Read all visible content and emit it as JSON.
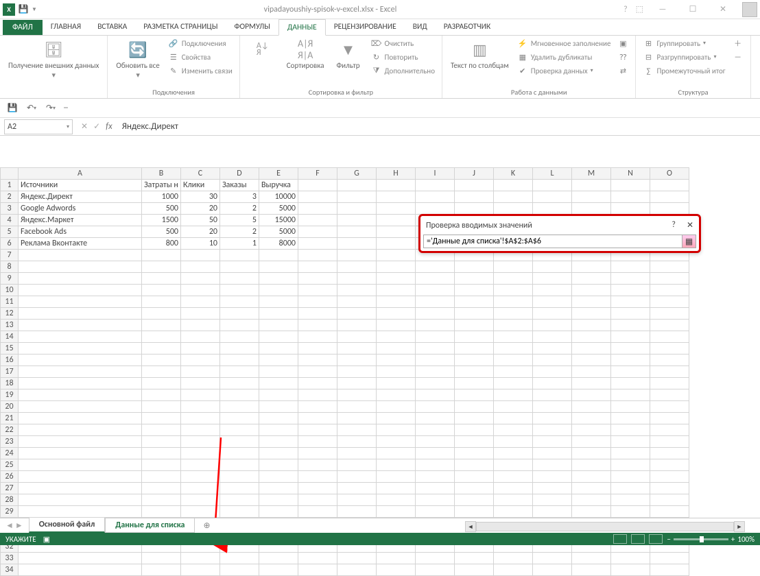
{
  "title": "vipadayoushiy-spisok-v-excel.xlsx - Excel",
  "tabs": {
    "file": "ФАЙЛ",
    "list": [
      "ГЛАВНАЯ",
      "ВСТАВКА",
      "РАЗМЕТКА СТРАНИЦЫ",
      "ФОРМУЛЫ",
      "ДАННЫЕ",
      "РЕЦЕНЗИРОВАНИЕ",
      "ВИД",
      "РАЗРАБОТЧИК"
    ],
    "active_index": 4
  },
  "ribbon": {
    "g1": {
      "btn": "Получение\nвнешних данных",
      "title": ""
    },
    "g2": {
      "refresh": "Обновить\nвсе",
      "conn": "Подключения",
      "props": "Свойства",
      "edit": "Изменить связи",
      "title": "Подключения"
    },
    "g3": {
      "sort": "Сортировка",
      "filter": "Фильтр",
      "clear": "Очистить",
      "reapply": "Повторить",
      "adv": "Дополнительно",
      "title": "Сортировка и фильтр"
    },
    "g4": {
      "ttc": "Текст по\nстолбцам",
      "flash": "Мгновенное заполнение",
      "dup": "Удалить дубликаты",
      "val": "Проверка данных",
      "title": "Работа с данными"
    },
    "g5": {
      "grp": "Группировать",
      "ungrp": "Разгруппировать",
      "sub": "Промежуточный итог",
      "title": "Структура"
    }
  },
  "namebox": "A2",
  "formula": "Яндекс.Директ",
  "columns": [
    "A",
    "B",
    "C",
    "D",
    "E",
    "F",
    "G",
    "H",
    "I",
    "J",
    "K",
    "L",
    "M",
    "N",
    "O"
  ],
  "headers": {
    "A": "Источники",
    "B": "Затраты н",
    "C": "Клики",
    "D": "Заказы",
    "E": "Выручка"
  },
  "rows": [
    {
      "A": "Яндекс.Директ",
      "B": 1000,
      "C": 30,
      "D": 3,
      "E": 10000
    },
    {
      "A": "Google Adwords",
      "B": 500,
      "C": 20,
      "D": 2,
      "E": 5000
    },
    {
      "A": "Яндекс.Маркет",
      "B": 1500,
      "C": 50,
      "D": 5,
      "E": 15000
    },
    {
      "A": "Facebook Ads",
      "B": 500,
      "C": 20,
      "D": 2,
      "E": 5000
    },
    {
      "A": "Реклама Вконтакте",
      "B": 800,
      "C": 10,
      "D": 1,
      "E": 8000
    }
  ],
  "blank_rows": 28,
  "validation": {
    "title": "Проверка вводимых значений",
    "formula": "='Данные для списка'!$A$2:$A$6"
  },
  "sheets": {
    "tabs": [
      "Основной файл",
      "Данные для списка"
    ],
    "active": 0,
    "highlight": 1
  },
  "status": {
    "mode": "УКАЖИТЕ",
    "zoom": "100%"
  }
}
